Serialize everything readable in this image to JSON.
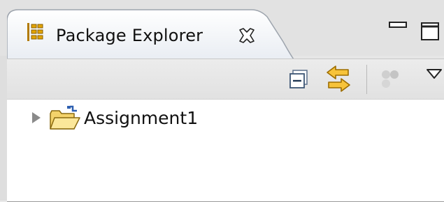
{
  "view": {
    "title": "Package Explorer",
    "icons": {
      "view_icon": "package-explorer-icon",
      "close": "close-icon",
      "minimize": "minimize-icon",
      "maximize": "maximize-icon"
    }
  },
  "toolbar": {
    "buttons": [
      {
        "name": "collapse-all",
        "icon": "collapse-all-icon"
      },
      {
        "name": "link-with-editor",
        "icon": "link-with-editor-icon"
      },
      {
        "name": "focus-on-active-task",
        "icon": "focus-icon"
      },
      {
        "name": "view-menu",
        "icon": "view-menu-chevron-icon"
      }
    ]
  },
  "tree": {
    "items": [
      {
        "label": "Assignment1",
        "icon": "project-folder-icon",
        "expanded": false
      }
    ]
  },
  "colors": {
    "accent": "#e2a400",
    "tab_fill": "#f4f6f9",
    "tree_bg": "#ffffff"
  }
}
